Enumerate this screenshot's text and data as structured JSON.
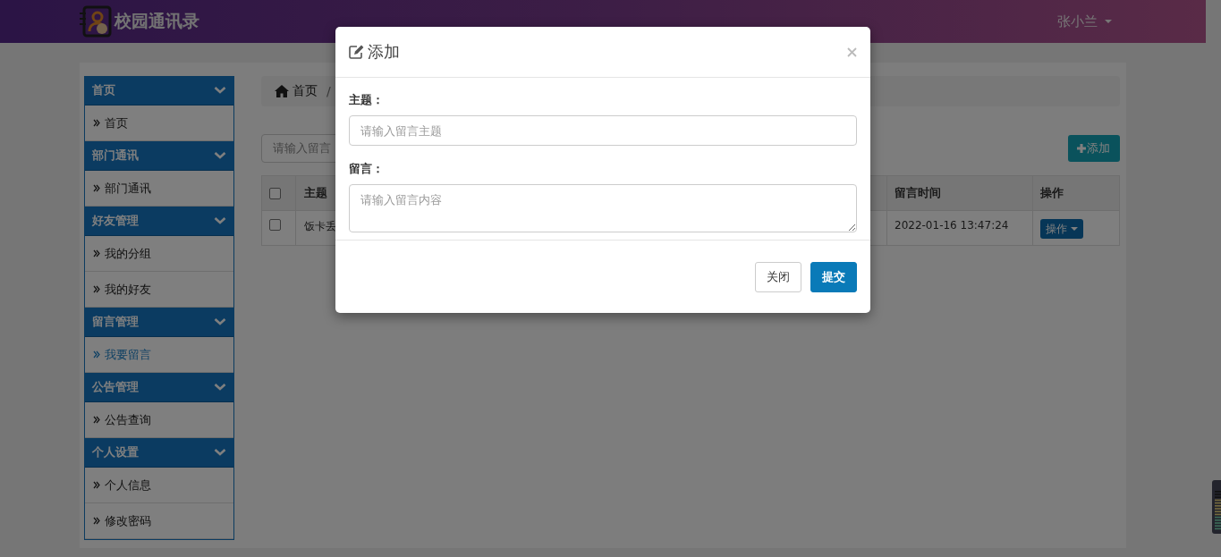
{
  "header": {
    "app_title": "校园通讯录",
    "user": {
      "name": "张小兰"
    }
  },
  "sidebar": {
    "groups": [
      {
        "title": "首页",
        "expanded": true,
        "items": [
          {
            "label": "首页",
            "selected": false
          }
        ]
      },
      {
        "title": "部门通讯",
        "expanded": true,
        "items": [
          {
            "label": "部门通讯",
            "selected": false
          }
        ]
      },
      {
        "title": "好友管理",
        "expanded": true,
        "items": [
          {
            "label": "我的分组",
            "selected": false
          },
          {
            "label": "我的好友",
            "selected": false
          }
        ]
      },
      {
        "title": "留言管理",
        "expanded": true,
        "items": [
          {
            "label": "我要留言",
            "selected": true
          }
        ]
      },
      {
        "title": "公告管理",
        "expanded": true,
        "items": [
          {
            "label": "公告查询",
            "selected": false
          }
        ]
      },
      {
        "title": "个人设置",
        "expanded": true,
        "items": [
          {
            "label": "个人信息",
            "selected": false
          },
          {
            "label": "修改密码",
            "selected": false
          }
        ]
      }
    ]
  },
  "breadcrumb": {
    "home": "首页",
    "separator": "/"
  },
  "search": {
    "placeholder": "请输入留言"
  },
  "add_button": {
    "label": "添加"
  },
  "table": {
    "header_checked": false,
    "columns": [
      "主题",
      "留言时间",
      "操作"
    ],
    "rows": [
      {
        "checked": false,
        "subject": "饭卡丢",
        "time": "2022-01-16 13:47:24",
        "action": "操作"
      }
    ]
  },
  "modal": {
    "title": "添加",
    "fields": [
      {
        "kind": "input",
        "label": "主题：",
        "placeholder": "请输入留言主题"
      },
      {
        "kind": "textarea",
        "label": "留言：",
        "placeholder": "请输入留言内容"
      }
    ],
    "buttons": [
      {
        "kind": "default",
        "label": "关闭"
      },
      {
        "kind": "primary",
        "label": "提交"
      }
    ]
  }
}
